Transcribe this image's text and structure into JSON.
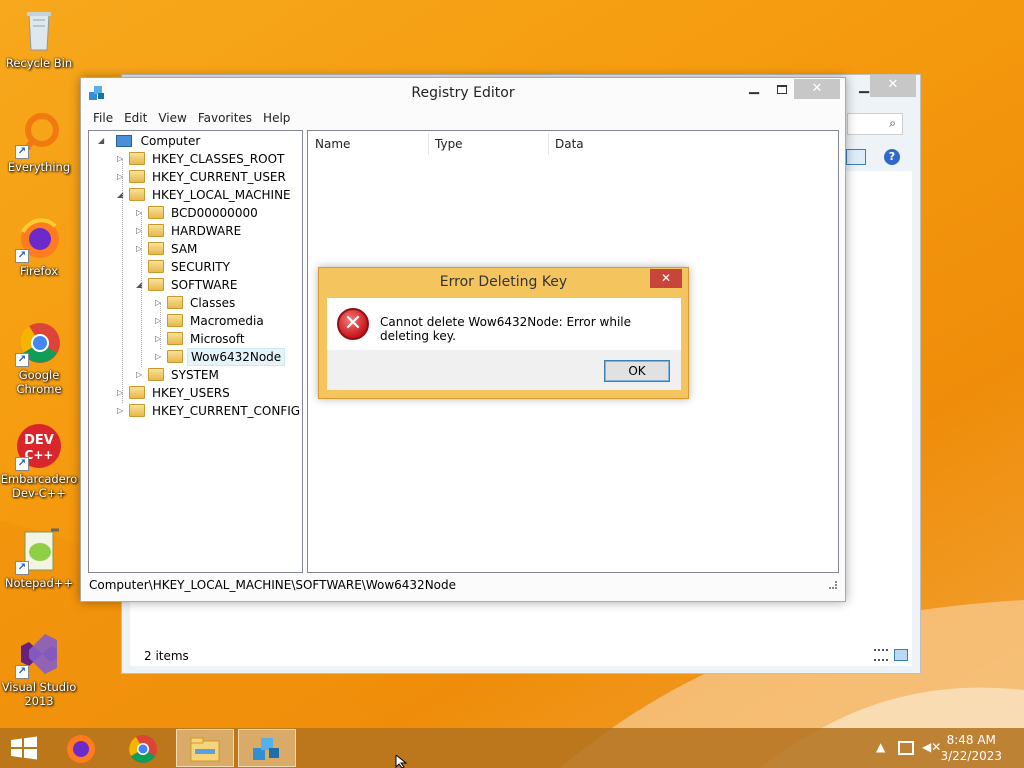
{
  "desktop": {
    "icons": [
      {
        "label": "Recycle Bin"
      },
      {
        "label": "Everything"
      },
      {
        "label": "Firefox"
      },
      {
        "label": "Google Chrome"
      },
      {
        "label": "Embarcadero Dev-C++"
      },
      {
        "label": "Notepad++"
      },
      {
        "label": "Visual Studio 2013"
      }
    ]
  },
  "explorer_bg": {
    "status_text": "2 items",
    "search_icon": "search-icon",
    "help_icon": "help-icon"
  },
  "regedit": {
    "title": "Registry Editor",
    "menu": [
      "File",
      "Edit",
      "View",
      "Favorites",
      "Help"
    ],
    "tree": [
      {
        "label": "Computer",
        "expander": "◢"
      },
      {
        "label": "HKEY_CLASSES_ROOT",
        "expander": "▷"
      },
      {
        "label": "HKEY_CURRENT_USER",
        "expander": "▷"
      },
      {
        "label": "HKEY_LOCAL_MACHINE",
        "expander": "◢"
      },
      {
        "label": "BCD00000000",
        "expander": "▷"
      },
      {
        "label": "HARDWARE",
        "expander": "▷"
      },
      {
        "label": "SAM",
        "expander": "▷"
      },
      {
        "label": "SECURITY",
        "expander": ""
      },
      {
        "label": "SOFTWARE",
        "expander": "◢"
      },
      {
        "label": "Classes",
        "expander": "▷"
      },
      {
        "label": "Macromedia",
        "expander": "▷"
      },
      {
        "label": "Microsoft",
        "expander": "▷"
      },
      {
        "label": "Wow6432Node",
        "expander": "▷"
      },
      {
        "label": "SYSTEM",
        "expander": "▷"
      },
      {
        "label": "HKEY_USERS",
        "expander": "▷"
      },
      {
        "label": "HKEY_CURRENT_CONFIG",
        "expander": "▷"
      }
    ],
    "selected_key": "Wow6432Node",
    "columns": [
      "Name",
      "Type",
      "Data"
    ],
    "status_path": "Computer\\HKEY_LOCAL_MACHINE\\SOFTWARE\\Wow6432Node"
  },
  "dialog": {
    "title": "Error Deleting Key",
    "message": "Cannot delete Wow6432Node:  Error while deleting key.",
    "ok_label": "OK",
    "close_glyph": "✕",
    "icon": "error-icon"
  },
  "taskbar": {
    "items": [
      "start-button",
      "firefox-icon",
      "chrome-icon",
      "file-explorer-icon",
      "registry-editor-icon"
    ],
    "time": "8:48 AM",
    "date": "3/22/2023"
  },
  "colors": {
    "desktop": "#f59a0e",
    "dialog_frame": "#f4c45f",
    "close_red": "#c7453b"
  }
}
